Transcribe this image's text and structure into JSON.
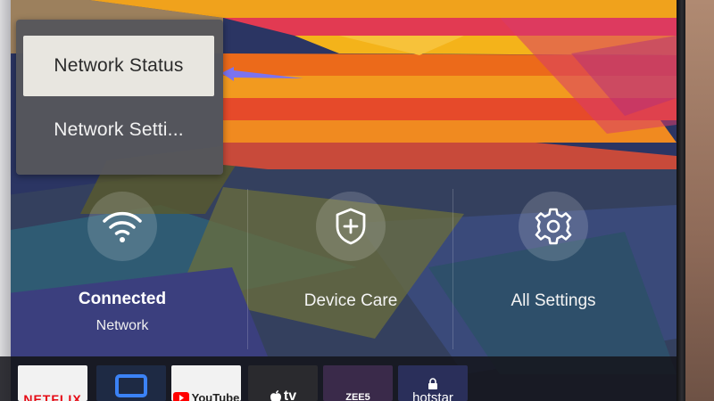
{
  "menu": {
    "items": [
      {
        "label": "Network Status",
        "selected": true
      },
      {
        "label": "Network Setti..."
      }
    ]
  },
  "tiles": [
    {
      "icon": "wifi-icon",
      "primary": "Connected",
      "secondary": "Network"
    },
    {
      "icon": "shield-plus-icon",
      "primary": "Device Care"
    },
    {
      "icon": "gear-icon",
      "primary": "All Settings"
    }
  ],
  "apps": [
    {
      "name": "NETFLIX",
      "bg": "#f2f2f2",
      "fg": "#e50914"
    },
    {
      "name": "",
      "bg": "#1e2a44",
      "fg": "#3b82f6",
      "icon": "screen-icon"
    },
    {
      "name": "YouTube",
      "bg": "#f2f2f2",
      "fg": "#222222"
    },
    {
      "name": "tv",
      "bg": "#2a2a2e",
      "fg": "#ffffff",
      "icon": "apple-icon"
    },
    {
      "name": "ZEE5",
      "bg": "#3a2a4a",
      "fg": "#ffffff"
    },
    {
      "name": "hotstar",
      "bg": "#2a2f5a",
      "fg": "#ffffff",
      "icon": "lock-icon"
    }
  ],
  "colors": {
    "selected_bg": "#e8e6e0",
    "menu_bg": "#56565c",
    "pointer": "#7b73f0"
  }
}
